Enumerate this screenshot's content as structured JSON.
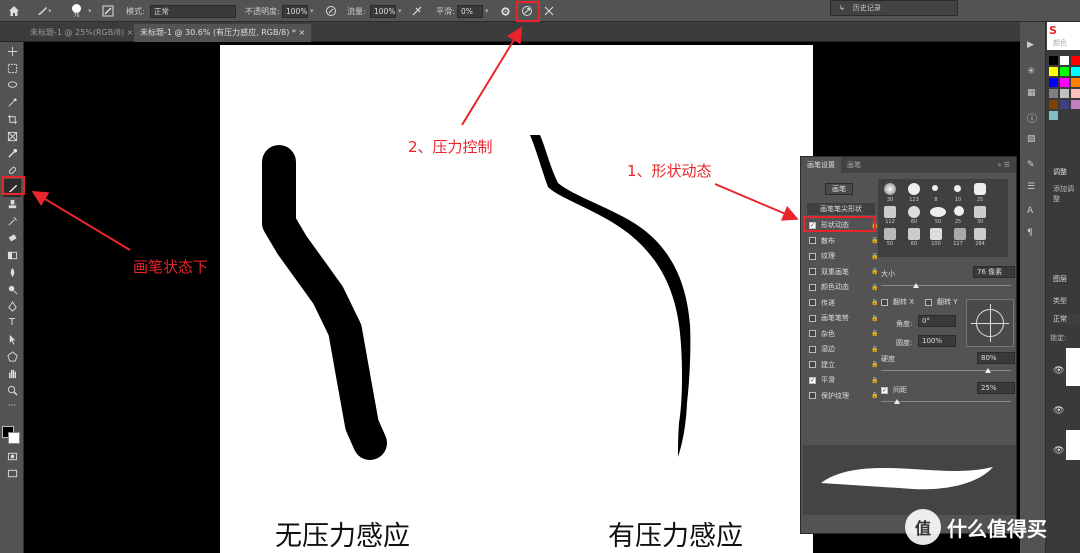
{
  "options_bar": {
    "brush_size": "76",
    "mode_label": "模式:",
    "mode_value": "正常",
    "opacity_label": "不透明度:",
    "opacity_value": "100%",
    "flow_label": "流量:",
    "flow_value": "100%",
    "smoothing_label": "平滑:",
    "smoothing_value": "0%"
  },
  "tabs": [
    {
      "label": "未标题-1 @ 25%(RGB/8)"
    },
    {
      "label": "未标题-1 @ 30.6% (有压力感应, RGB/8) *"
    }
  ],
  "history_panel_label": "历史记录",
  "canvas": {
    "caption_left": "无压力感应",
    "caption_right": "有压力感应"
  },
  "annotations": {
    "pressure_control": "2、压力控制",
    "shape_dynamics": "1、形状动态",
    "brush_state": "画笔状态下"
  },
  "brush_panel": {
    "tab_settings": "画笔设置",
    "tab_brushes": "画笔",
    "brushes_button": "画笔",
    "tip_shape": "画笔笔尖形状",
    "items": [
      {
        "label": "形状动态",
        "checked": true
      },
      {
        "label": "散布",
        "checked": false
      },
      {
        "label": "纹理",
        "checked": false
      },
      {
        "label": "双重画笔",
        "checked": false
      },
      {
        "label": "颜色动态",
        "checked": false
      },
      {
        "label": "传递",
        "checked": false
      },
      {
        "label": "画笔笔势",
        "checked": false
      },
      {
        "label": "杂色",
        "checked": false
      },
      {
        "label": "湿边",
        "checked": false
      },
      {
        "label": "建立",
        "checked": false
      },
      {
        "label": "平滑",
        "checked": true
      },
      {
        "label": "保护纹理",
        "checked": false
      }
    ],
    "tip_sizes_row1": [
      "30",
      "123",
      "8",
      "10",
      "25"
    ],
    "tip_sizes_row2": [
      "112",
      "60",
      "50",
      "25",
      "30"
    ],
    "tip_sizes_row3": [
      "50",
      "60",
      "100",
      "127",
      "284"
    ],
    "size_label": "大小",
    "size_value": "76 像素",
    "flip_x": "翻转 X",
    "flip_y": "翻转 Y",
    "angle_label": "角度:",
    "angle_value": "0°",
    "roundness_label": "圆度:",
    "roundness_value": "100%",
    "hardness_label": "硬度",
    "hardness_value": "80%",
    "spacing_label": "间距",
    "spacing_value": "25%"
  },
  "right_panels": {
    "color_tab": "颜色",
    "adjust_tab": "调整",
    "add_adjust": "添加调整",
    "layers_tab": "图层",
    "kind_label": "类型",
    "blend_mode": "正常",
    "lock_label": "锁定:"
  },
  "watermark": "什么值得买",
  "swatch_colors": [
    "#000000",
    "#ffffff",
    "#ff0000",
    "#ffff00",
    "#00ff00",
    "#00ffff",
    "#0000ff",
    "#ff00ff",
    "#ff7f00",
    "#7f7f7f",
    "#c0c0c0",
    "#ffbfbf",
    "#7f3f00",
    "#3f3f7f",
    "#bf7fbf",
    "#7fbfbf"
  ]
}
